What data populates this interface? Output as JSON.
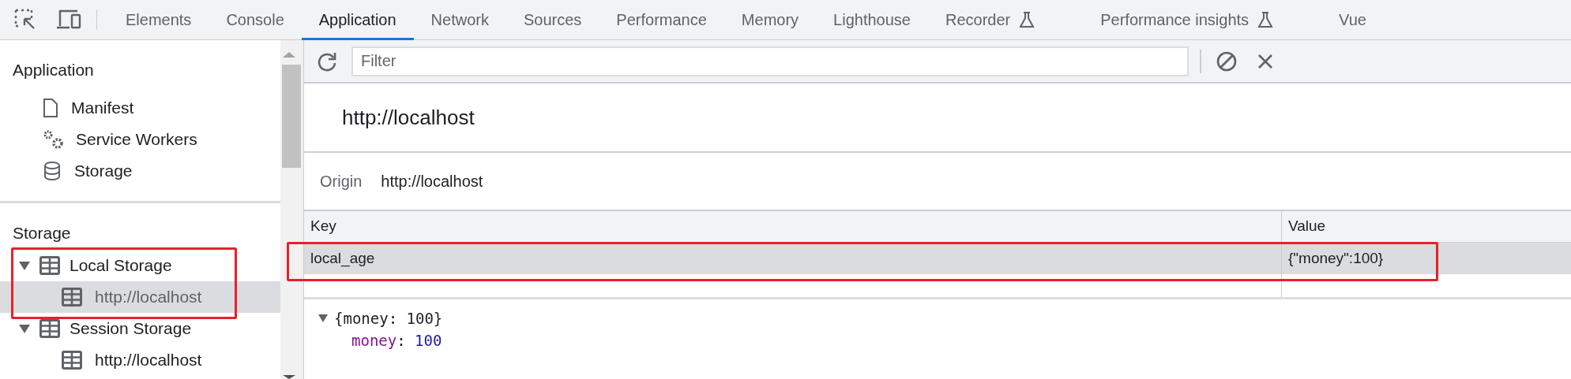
{
  "tabs": [
    {
      "label": "Elements",
      "selected": false,
      "experimental": false
    },
    {
      "label": "Console",
      "selected": false,
      "experimental": false
    },
    {
      "label": "Application",
      "selected": true,
      "experimental": false
    },
    {
      "label": "Network",
      "selected": false,
      "experimental": false
    },
    {
      "label": "Sources",
      "selected": false,
      "experimental": false
    },
    {
      "label": "Performance",
      "selected": false,
      "experimental": false
    },
    {
      "label": "Memory",
      "selected": false,
      "experimental": false
    },
    {
      "label": "Lighthouse",
      "selected": false,
      "experimental": false
    },
    {
      "label": "Recorder",
      "selected": false,
      "experimental": true
    },
    {
      "label": "Performance insights",
      "selected": false,
      "experimental": true
    },
    {
      "label": "Vue",
      "selected": false,
      "experimental": false
    }
  ],
  "sidebar": {
    "sections": [
      {
        "title": "Application",
        "items": [
          {
            "label": "Manifest",
            "kind": "file",
            "selected": false
          },
          {
            "label": "Service Workers",
            "kind": "worker",
            "selected": false
          },
          {
            "label": "Storage",
            "kind": "database",
            "selected": false
          }
        ]
      },
      {
        "title": "Storage",
        "items": [
          {
            "label": "Local Storage",
            "kind": "table",
            "selected": false,
            "expanded": true,
            "children": [
              {
                "label": "http://localhost",
                "kind": "table",
                "selected": true
              }
            ]
          },
          {
            "label": "Session Storage",
            "kind": "table",
            "selected": false,
            "expanded": true,
            "children": [
              {
                "label": "http://localhost",
                "kind": "table",
                "selected": false
              }
            ]
          }
        ]
      }
    ]
  },
  "toolbar": {
    "filter_placeholder": "Filter"
  },
  "storage": {
    "title": "http://localhost",
    "origin_label": "Origin",
    "origin_value": "http://localhost",
    "columns": [
      "Key",
      "Value"
    ],
    "rows": [
      {
        "key": "local_age",
        "value": "{\"money\":100}",
        "selected": true
      }
    ],
    "preview": {
      "summary": "{money: 100}",
      "expanded": true,
      "properties": [
        {
          "key": "money",
          "separator": ":",
          "value": "100"
        }
      ]
    }
  }
}
